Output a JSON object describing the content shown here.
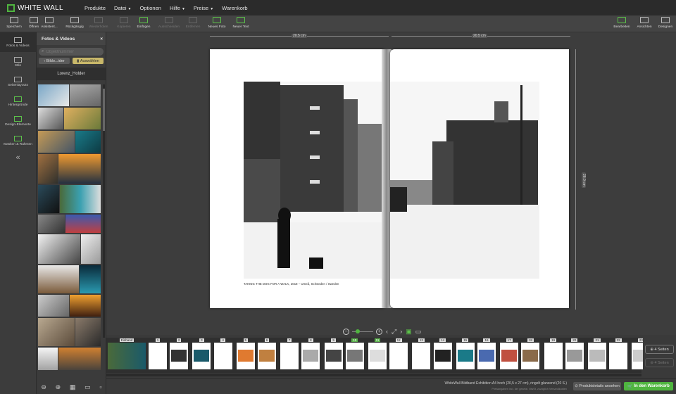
{
  "app": {
    "logo_text": "WHITE WALL"
  },
  "menu": [
    {
      "label": "Produkte",
      "caret": ""
    },
    {
      "label": "Datei",
      "caret": "▼"
    },
    {
      "label": "Optionen",
      "caret": ""
    },
    {
      "label": "Hilfe",
      "caret": "▼"
    },
    {
      "label": "Preise",
      "caret": "▼"
    },
    {
      "label": "Warenkorb",
      "caret": ""
    }
  ],
  "toolbar": {
    "left": [
      {
        "label": "Speichern",
        "enabled": true
      },
      {
        "label": "Öffnen",
        "enabled": true
      },
      {
        "label": "Assistent...",
        "enabled": true
      },
      {
        "label": "Rückgängig",
        "enabled": true
      },
      {
        "label": "Wiederholen",
        "enabled": false
      },
      {
        "label": "Kopieren",
        "enabled": false
      },
      {
        "label": "Einfügen",
        "enabled": true
      },
      {
        "label": "Ausschneiden",
        "enabled": false
      },
      {
        "label": "Entfernen",
        "enabled": false
      },
      {
        "label": "Neues Foto",
        "enabled": true
      },
      {
        "label": "Neuer Text",
        "enabled": true
      }
    ],
    "right": [
      {
        "label": "Bearbeiten",
        "enabled": true
      },
      {
        "label": "Ansichten",
        "enabled": true
      },
      {
        "label": "Designen",
        "enabled": true
      }
    ]
  },
  "leftnav": {
    "items": [
      {
        "label": "Fotos & Videos",
        "active": true
      },
      {
        "label": "Stile",
        "active": false
      },
      {
        "label": "Seitenlayouts",
        "active": false
      },
      {
        "label": "Hintergründe",
        "active": false
      },
      {
        "label": "Design-Elemente",
        "active": false
      },
      {
        "label": "Masken & Rahmen",
        "active": false
      }
    ],
    "collapse": "«"
  },
  "panel": {
    "title": "Fotos & Videos",
    "close": "×",
    "search_placeholder": "Objektnummer",
    "back_label": "Bildo...ider",
    "select_label": "Auswählen",
    "folder_name": "Lorenz_Holder"
  },
  "rulers": {
    "top_left": "20.5 cm",
    "top_right": "20.5 cm",
    "right": "28.0 cm"
  },
  "page": {
    "caption": "TAKING THE DOG FOR A WALK, 2018 – Umeå, Schweden / Sweden"
  },
  "filmstrip": {
    "cover_label": "Einband",
    "pages": [
      "1",
      "2",
      "3",
      "4",
      "5",
      "6",
      "7",
      "8",
      "9",
      "10",
      "11",
      "12",
      "13",
      "14",
      "15",
      "16",
      "17",
      "18",
      "19",
      "20",
      "21",
      "22",
      "23"
    ],
    "active_pages": [
      "10",
      "11"
    ]
  },
  "strip_side": {
    "add_label": "4 Seiten",
    "remove_label": "4 Seiten"
  },
  "status": {
    "info": "WhiteWall Bildband Exhibition A4 hoch (20,5 x 27 cm), ringelt glanzend (20 S.)",
    "sub": "Preisangaben incl. der gesetzl. MwSt. zuzüglich Versandkosten",
    "preview_label": "Produktdetails ansehen",
    "cart_label": "In den Warenkorb"
  },
  "colors": {
    "accent": "#4fb53f",
    "toolbar": "#444444",
    "panel": "#3b3b3b"
  }
}
